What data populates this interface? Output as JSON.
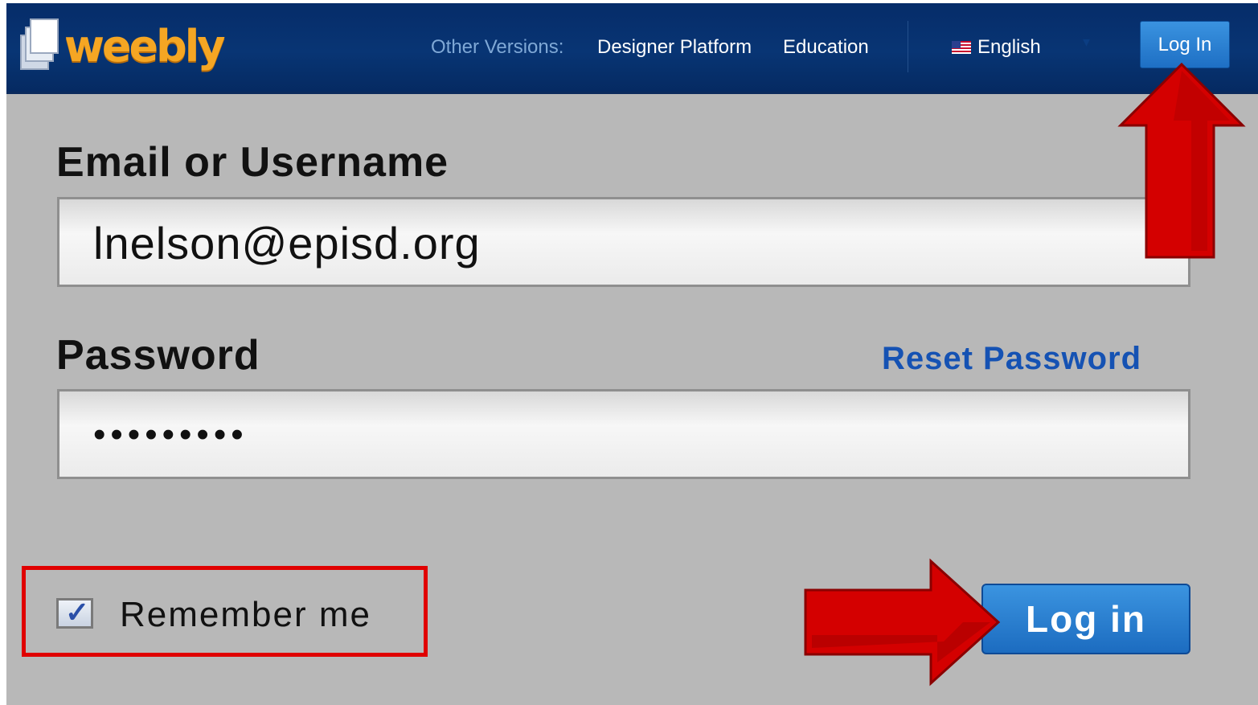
{
  "header": {
    "brand": "weebly",
    "other_versions_label": "Other Versions:",
    "designer_platform_label": "Designer Platform",
    "education_label": "Education",
    "language_label": "English",
    "login_label": "Log In"
  },
  "form": {
    "email_label": "Email or Username",
    "email_value": "lnelson@episd.org",
    "password_label": "Password",
    "reset_password_label": "Reset Password",
    "password_mask": "•••••••••",
    "remember_label": "Remember me",
    "remember_checked": true,
    "submit_label": "Log in"
  },
  "annotations": {
    "highlight_color": "#e00000",
    "arrow_color": "#d40000",
    "icons": [
      "arrow-up-icon",
      "arrow-right-icon"
    ]
  },
  "colors": {
    "header_bg": "#083574",
    "page_bg": "#b8b8b8",
    "logo_orange": "#f5a623",
    "button_blue": "#1e6fc4",
    "link_blue": "#1552b3"
  }
}
